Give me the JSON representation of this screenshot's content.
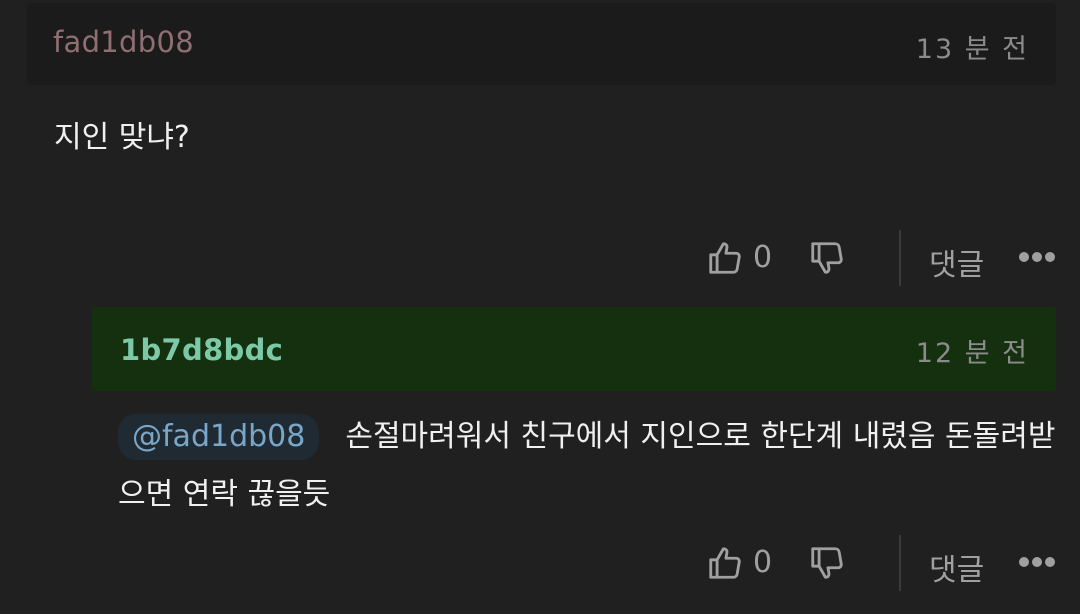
{
  "comment": {
    "username": "fad1db08",
    "time": "13 분 전",
    "body": "지인 맞냐?",
    "likes": "0",
    "reply_label": "댓글"
  },
  "reply": {
    "username": "1b7d8bdc",
    "time": "12 분 전",
    "mention": "@fad1db08",
    "body": "손절마려워서 친구에서 지인으로 한단계 내렸음 돈돌려받으면 연락 끊을듯",
    "likes": "0",
    "reply_label": "댓글"
  },
  "icons": {
    "like": "thumbs-up-icon",
    "dislike": "thumbs-down-icon",
    "more": "more-dots-icon"
  },
  "colors": {
    "background": "#202020",
    "reply_header": "#14300f",
    "reply_username": "#7cc9a7",
    "main_username": "#8f6f72",
    "mention": "#7aa6c8"
  }
}
